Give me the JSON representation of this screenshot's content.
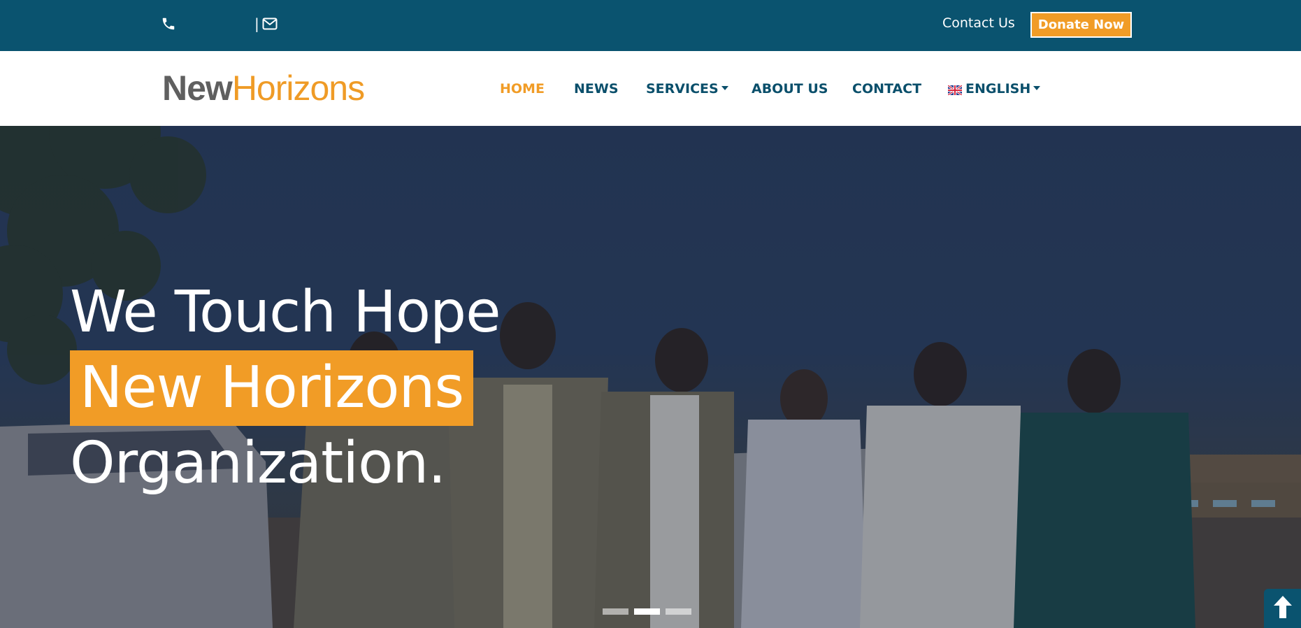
{
  "topbar": {
    "phone_icon": "phone-icon",
    "phone_number": "",
    "divider": "|",
    "mail_icon": "envelope-icon",
    "contact_link": "Contact Us",
    "donate_label": "Donate Now",
    "background_color": "#0a536f",
    "donate_color": "#f19c26"
  },
  "logo": {
    "part1": "New",
    "part2": "Horizons"
  },
  "nav": {
    "items": [
      {
        "label": "HOME",
        "active": true
      },
      {
        "label": "NEWS",
        "active": false
      },
      {
        "label": "SERVICES",
        "active": false,
        "dropdown": true
      },
      {
        "label": "ABOUT US",
        "active": false
      },
      {
        "label": "CONTACT",
        "active": false
      },
      {
        "label": "ENGLISH",
        "active": false,
        "dropdown": true,
        "icon": "uk-flag-icon"
      }
    ]
  },
  "hero": {
    "line1": "We Touch Hope",
    "line2": "New Horizons",
    "line3": "Organization.",
    "highlight_color": "#f19c26",
    "slides": 3,
    "active_slide": 2
  },
  "scroll_top": {
    "icon": "arrow-up-icon"
  }
}
